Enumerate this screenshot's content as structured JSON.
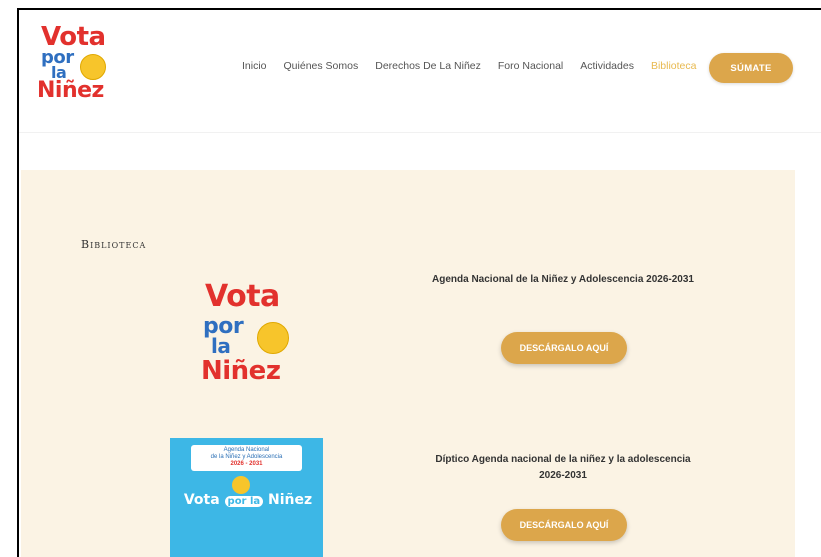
{
  "header": {
    "logo": {
      "word1": "Vota",
      "word2": "por",
      "word3": "la",
      "word4": "Niñez"
    },
    "nav": [
      {
        "label": "Inicio",
        "active": false
      },
      {
        "label": "Quiénes Somos",
        "active": false
      },
      {
        "label": "Derechos De La Niñez",
        "active": false
      },
      {
        "label": "Foro Nacional",
        "active": false
      },
      {
        "label": "Actividades",
        "active": false
      },
      {
        "label": "Biblioteca",
        "active": true
      }
    ],
    "cta_label": "SÚMATE"
  },
  "library": {
    "title": "Biblioteca",
    "items": [
      {
        "title": "Agenda Nacional de la Niñez y Adolescencia 2026-2031",
        "button": "DESCÁRGALO AQUÍ"
      },
      {
        "title": "Díptico Agenda nacional de la niñez y la adolescencia 2026-2031",
        "button": "DESCÁRGALO AQUÍ"
      }
    ],
    "cover": {
      "head_line1": "Agenda Nacional",
      "head_line2": "de la Niñez y Adolescencia",
      "head_line3": "2026 - 2031",
      "title_a": "Vota",
      "title_b": "por la",
      "title_c": "Niñez"
    }
  },
  "colors": {
    "accent": "#dca64b",
    "active_nav": "#e8b94f",
    "section_bg": "#fbf3e4",
    "logo_red": "#e2312d",
    "logo_blue": "#2f6fc0",
    "logo_yellow": "#f7c52b"
  }
}
